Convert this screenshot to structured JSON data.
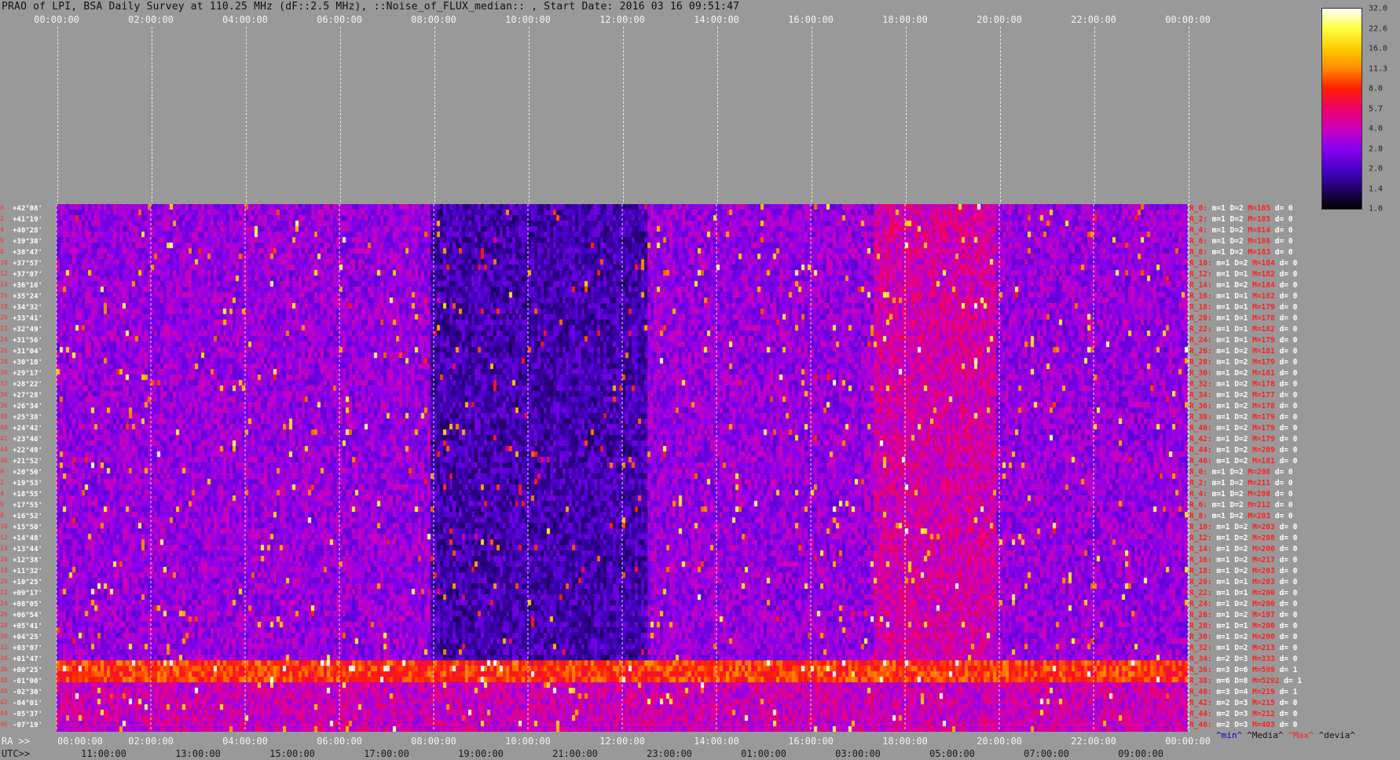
{
  "title": "PRAO of LPI, BSA Daily Survey at 110.25 MHz (dF::2.5 MHz), ::Noise_of_FLUX_median:: , Start Date: 2016 03 16 09:51:47",
  "chart_data": {
    "type": "heatmap",
    "top_axis_ticks": [
      "00:00:00",
      "02:00:00",
      "04:00:00",
      "06:00:00",
      "08:00:00",
      "10:00:00",
      "12:00:00",
      "14:00:00",
      "16:00:00",
      "18:00:00",
      "20:00:00",
      "22:00:00",
      "00:00:00"
    ],
    "ra_lead": "RA >>",
    "ra_ticks": [
      "00:00:00",
      "02:00:00",
      "04:00:00",
      "06:00:00",
      "08:00:00",
      "10:00:00",
      "12:00:00",
      "14:00:00",
      "16:00:00",
      "18:00:00",
      "20:00:00",
      "22:00:00",
      "00:00:00"
    ],
    "utc_lead": "UTC>>",
    "utc_ticks": [
      "11:00:00",
      "13:00:00",
      "15:00:00",
      "17:00:00",
      "19:00:00",
      "21:00:00",
      "23:00:00",
      "01:00:00",
      "03:00:00",
      "05:00:00",
      "07:00:00",
      "09:00:00"
    ],
    "dec_labels": [
      "+42°08'",
      "+41°19'",
      "+40°28'",
      "+39°38'",
      "+38°47'",
      "+37°57'",
      "+37°07'",
      "+36°16'",
      "+35°24'",
      "+34°32'",
      "+33°41'",
      "+32°49'",
      "+31°56'",
      "+31°04'",
      "+30°10'",
      "+29°17'",
      "+28°22'",
      "+27°28'",
      "+26°34'",
      "+25°38'",
      "+24°42'",
      "+23°46'",
      "+22°49'",
      "+21°52'",
      "+20°50'",
      "+19°53'",
      "+18°55'",
      "+17°55'",
      "+16°52'",
      "+15°50'",
      "+14°48'",
      "+13°44'",
      "+12°38'",
      "+11°32'",
      "+10°25'",
      "+09°17'",
      "+08°05'",
      "+06°54'",
      "+05°41'",
      "+04°25'",
      "+03°07'",
      "+01°47'",
      "+00°25'",
      "-01°00'",
      "-02°30'",
      "-04°01'",
      "-05°37'",
      "-07°19'"
    ],
    "row_indices": [
      "0",
      "2",
      "4",
      "6",
      "8",
      "10",
      "12",
      "14",
      "16",
      "18",
      "20",
      "22",
      "24",
      "26",
      "28",
      "30",
      "32",
      "34",
      "36",
      "38",
      "40",
      "42",
      "44",
      "46",
      "0",
      "2",
      "4",
      "6",
      "8",
      "10",
      "12",
      "14",
      "16",
      "18",
      "20",
      "22",
      "24",
      "26",
      "28",
      "30",
      "32",
      "34",
      "36",
      "38",
      "40",
      "42",
      "44",
      "46"
    ],
    "row_stats": [
      {
        "r": "R_0:",
        "m": "m=1",
        "D": "D=2",
        "M": "M=185",
        "d": "d= 0"
      },
      {
        "r": "R_2:",
        "m": "m=1",
        "D": "D=2",
        "M": "M=185",
        "d": "d= 0"
      },
      {
        "r": "R_4:",
        "m": "m=1",
        "D": "D=2",
        "M": "M=814",
        "d": "d= 0"
      },
      {
        "r": "R_6:",
        "m": "m=1",
        "D": "D=2",
        "M": "M=186",
        "d": "d= 0"
      },
      {
        "r": "R_8:",
        "m": "m=1",
        "D": "D=2",
        "M": "M=183",
        "d": "d= 0"
      },
      {
        "r": "R_10:",
        "m": "m=1",
        "D": "D=2",
        "M": "M=184",
        "d": "d= 0"
      },
      {
        "r": "R_12:",
        "m": "m=1",
        "D": "D=1",
        "M": "M=182",
        "d": "d= 0"
      },
      {
        "r": "R_14:",
        "m": "m=1",
        "D": "D=2",
        "M": "M=184",
        "d": "d= 0"
      },
      {
        "r": "R_16:",
        "m": "m=1",
        "D": "D=1",
        "M": "M=182",
        "d": "d= 0"
      },
      {
        "r": "R_18:",
        "m": "m=1",
        "D": "D=1",
        "M": "M=179",
        "d": "d= 0"
      },
      {
        "r": "R_20:",
        "m": "m=1",
        "D": "D=1",
        "M": "M=178",
        "d": "d= 0"
      },
      {
        "r": "R_22:",
        "m": "m=1",
        "D": "D=1",
        "M": "M=182",
        "d": "d= 0"
      },
      {
        "r": "R_24:",
        "m": "m=1",
        "D": "D=1",
        "M": "M=179",
        "d": "d= 0"
      },
      {
        "r": "R_26:",
        "m": "m=1",
        "D": "D=2",
        "M": "M=181",
        "d": "d= 0"
      },
      {
        "r": "R_28:",
        "m": "m=1",
        "D": "D=2",
        "M": "M=179",
        "d": "d= 0"
      },
      {
        "r": "R_30:",
        "m": "m=1",
        "D": "D=2",
        "M": "M=181",
        "d": "d= 0"
      },
      {
        "r": "R_32:",
        "m": "m=1",
        "D": "D=2",
        "M": "M=178",
        "d": "d= 0"
      },
      {
        "r": "R_34:",
        "m": "m=1",
        "D": "D=2",
        "M": "M=177",
        "d": "d= 0"
      },
      {
        "r": "R_36:",
        "m": "m=1",
        "D": "D=2",
        "M": "M=178",
        "d": "d= 0"
      },
      {
        "r": "R_38:",
        "m": "m=1",
        "D": "D=2",
        "M": "M=179",
        "d": "d= 0"
      },
      {
        "r": "R_40:",
        "m": "m=1",
        "D": "D=2",
        "M": "M=179",
        "d": "d= 0"
      },
      {
        "r": "R_42:",
        "m": "m=1",
        "D": "D=2",
        "M": "M=179",
        "d": "d= 0"
      },
      {
        "r": "R_44:",
        "m": "m=1",
        "D": "D=2",
        "M": "M=209",
        "d": "d= 0"
      },
      {
        "r": "R_46:",
        "m": "m=1",
        "D": "D=2",
        "M": "M=181",
        "d": "d= 0"
      },
      {
        "r": "R_0:",
        "m": "m=1",
        "D": "D=2",
        "M": "M=208",
        "d": "d= 0"
      },
      {
        "r": "R_2:",
        "m": "m=1",
        "D": "D=2",
        "M": "M=211",
        "d": "d= 0"
      },
      {
        "r": "R_4:",
        "m": "m=1",
        "D": "D=2",
        "M": "M=208",
        "d": "d= 0"
      },
      {
        "r": "R_6:",
        "m": "m=1",
        "D": "D=2",
        "M": "M=212",
        "d": "d= 0"
      },
      {
        "r": "R_8:",
        "m": "m=1",
        "D": "D=2",
        "M": "M=203",
        "d": "d= 0"
      },
      {
        "r": "R_10:",
        "m": "m=1",
        "D": "D=2",
        "M": "M=203",
        "d": "d= 0"
      },
      {
        "r": "R_12:",
        "m": "m=1",
        "D": "D=2",
        "M": "M=208",
        "d": "d= 0"
      },
      {
        "r": "R_14:",
        "m": "m=1",
        "D": "D=2",
        "M": "M=206",
        "d": "d= 0"
      },
      {
        "r": "R_16:",
        "m": "m=1",
        "D": "D=2",
        "M": "M=217",
        "d": "d= 0"
      },
      {
        "r": "R_18:",
        "m": "m=1",
        "D": "D=2",
        "M": "M=203",
        "d": "d= 0"
      },
      {
        "r": "R_20:",
        "m": "m=1",
        "D": "D=1",
        "M": "M=203",
        "d": "d= 0"
      },
      {
        "r": "R_22:",
        "m": "m=1",
        "D": "D=1",
        "M": "M=200",
        "d": "d= 0"
      },
      {
        "r": "R_24:",
        "m": "m=1",
        "D": "D=2",
        "M": "M=200",
        "d": "d= 0"
      },
      {
        "r": "R_26:",
        "m": "m=1",
        "D": "D=2",
        "M": "M=197",
        "d": "d= 0"
      },
      {
        "r": "R_28:",
        "m": "m=1",
        "D": "D=1",
        "M": "M=200",
        "d": "d= 0"
      },
      {
        "r": "R_30:",
        "m": "m=1",
        "D": "D=2",
        "M": "M=200",
        "d": "d= 0"
      },
      {
        "r": "R_32:",
        "m": "m=1",
        "D": "D=2",
        "M": "M=213",
        "d": "d= 0"
      },
      {
        "r": "R_34:",
        "m": "m=2",
        "D": "D=3",
        "M": "M=333",
        "d": "d= 0"
      },
      {
        "r": "R_36:",
        "m": "m=3",
        "D": "D=6",
        "M": "M=599",
        "d": "d= 1"
      },
      {
        "r": "R_38:",
        "m": "m=6",
        "D": "D=8",
        "M": "M=5292",
        "d": "d= 1"
      },
      {
        "r": "R_40:",
        "m": "m=3",
        "D": "D=4",
        "M": "M=219",
        "d": "d= 1"
      },
      {
        "r": "R_42:",
        "m": "m=2",
        "D": "D=3",
        "M": "M=215",
        "d": "d= 0"
      },
      {
        "r": "R_44:",
        "m": "m=2",
        "D": "D=3",
        "M": "M=212",
        "d": "d= 0"
      },
      {
        "r": "R_46:",
        "m": "m=2",
        "D": "D=3",
        "M": "M=403",
        "d": "d= 0"
      }
    ],
    "footer_legend": [
      "^min^",
      "^Media^",
      "^Max^",
      "^devia^"
    ],
    "footer_colors": [
      "#0000cc",
      "#111111",
      "#ff2020",
      "#111111"
    ],
    "colorbar": {
      "labels": [
        "32.0",
        "22.6",
        "16.0",
        "11.3",
        "8.0",
        "5.7",
        "4.0",
        "2.8",
        "2.0",
        "1.4",
        "1.0"
      ],
      "colors": [
        "#ffffff",
        "#ffff40",
        "#ffcc00",
        "#ff8800",
        "#ff2000",
        "#ee0066",
        "#cc00bb",
        "#8a00ee",
        "#4a00cc",
        "#20006a",
        "#000000"
      ],
      "scale": "log"
    }
  }
}
